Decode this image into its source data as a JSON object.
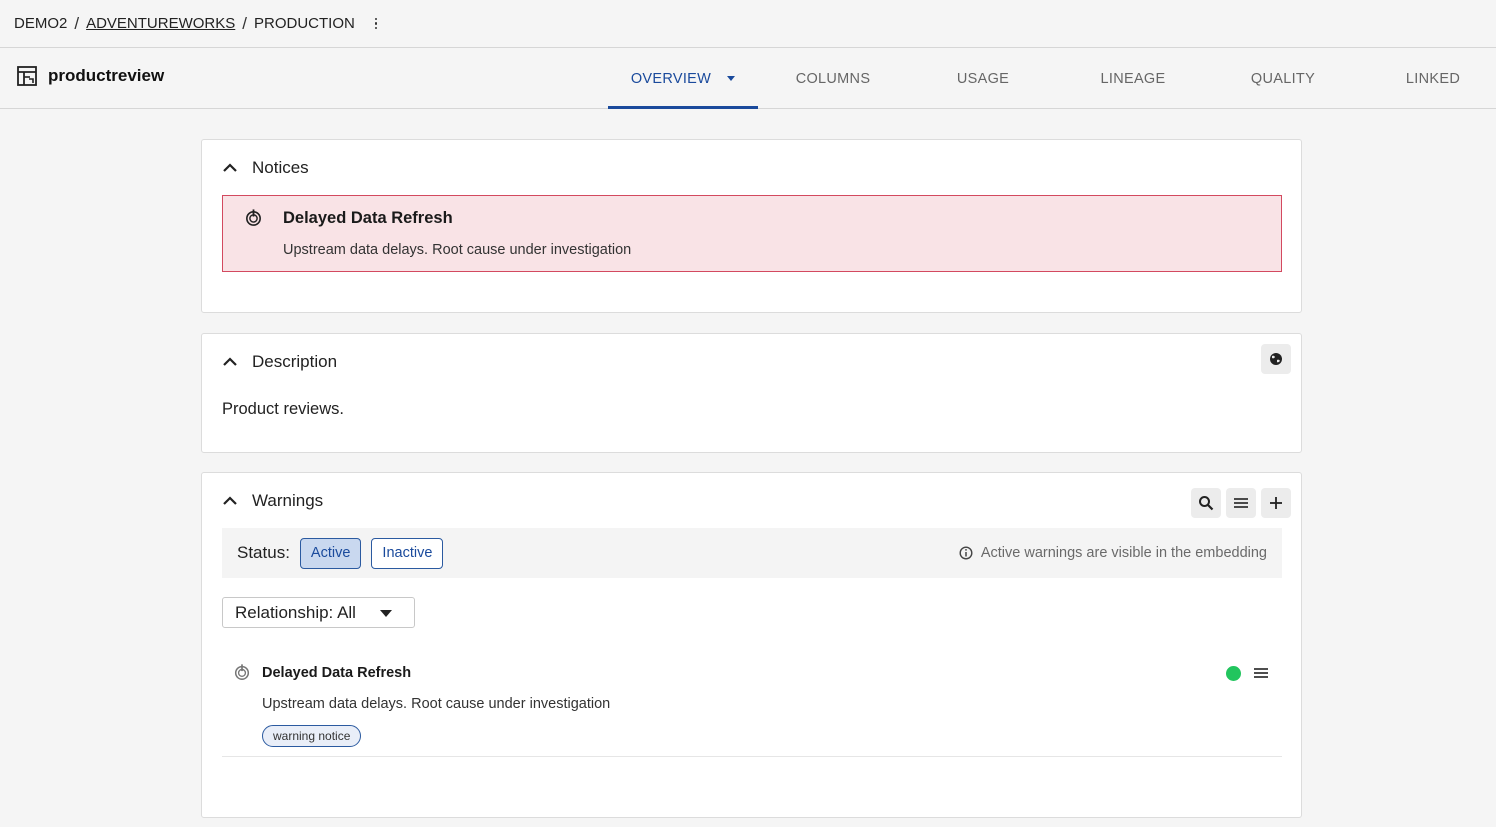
{
  "breadcrumb": {
    "items": [
      "DEMO2",
      "ADVENTUREWORKS",
      "PRODUCTION"
    ],
    "more_icon": "vertical-dots-icon"
  },
  "header": {
    "title": "productreview",
    "icon": "table-icon",
    "tabs": [
      {
        "label": "OVERVIEW",
        "active": true
      },
      {
        "label": "COLUMNS",
        "active": false
      },
      {
        "label": "USAGE",
        "active": false
      },
      {
        "label": "LINEAGE",
        "active": false
      },
      {
        "label": "QUALITY",
        "active": false
      },
      {
        "label": "LINKED",
        "active": false
      }
    ],
    "accent_color": "#1a4a9c"
  },
  "notices": {
    "title": "Notices",
    "item": {
      "title": "Delayed Data Refresh",
      "body": "Upstream data delays. Root cause under investigation",
      "icon": "power-icon",
      "bg_color": "#f9e3e6",
      "border_color": "#d3495f"
    }
  },
  "description": {
    "title": "Description",
    "text": "Product reviews.",
    "action_icon": "globe-icon"
  },
  "warnings": {
    "title": "Warnings",
    "tools": [
      "search-icon",
      "list-icon",
      "plus-icon"
    ],
    "status_label": "Status:",
    "status_options": [
      {
        "label": "Active",
        "selected": true
      },
      {
        "label": "Inactive",
        "selected": false
      }
    ],
    "hint": "Active warnings are visible in the embedding",
    "relationship": "Relationship: All",
    "item": {
      "title": "Delayed Data Refresh",
      "body": "Upstream data delays. Root cause under investigation",
      "tag": "warning notice",
      "status_color": "#22c55e"
    }
  }
}
